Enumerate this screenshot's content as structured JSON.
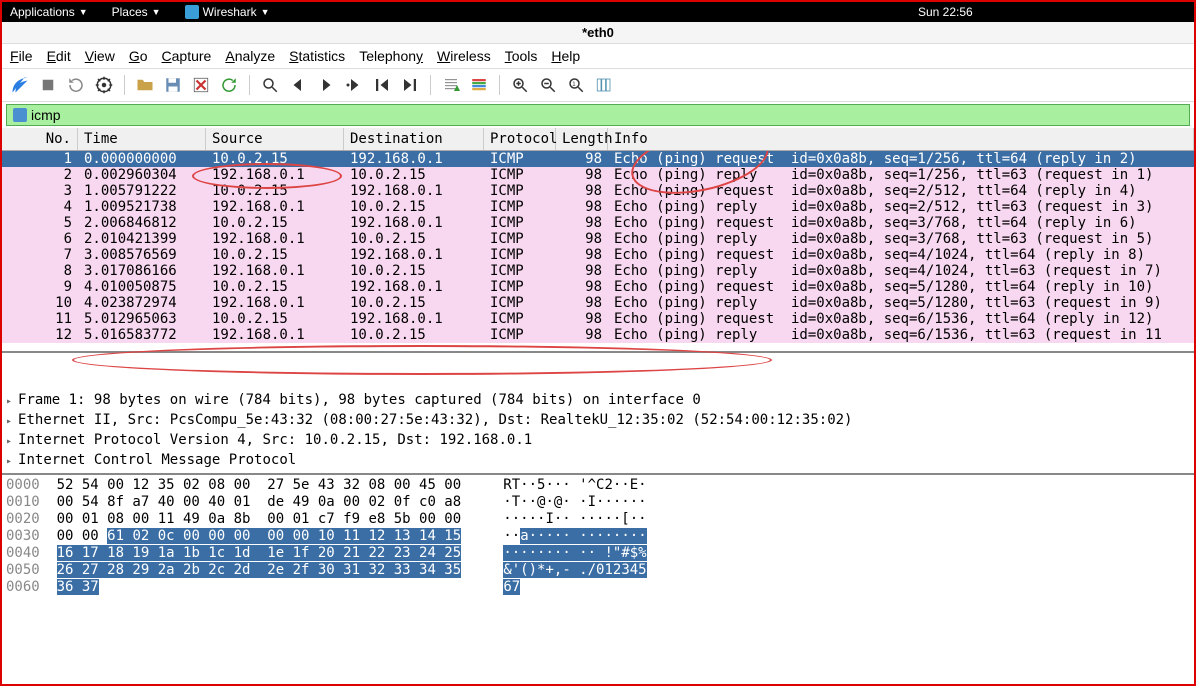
{
  "topbar": {
    "applications": "Applications",
    "places": "Places",
    "wireshark": "Wireshark",
    "clock": "Sun 22:56"
  },
  "title": "*eth0",
  "menubar": [
    "File",
    "Edit",
    "View",
    "Go",
    "Capture",
    "Analyze",
    "Statistics",
    "Telephony",
    "Wireless",
    "Tools",
    "Help"
  ],
  "filter": {
    "value": "icmp"
  },
  "columns": {
    "no": "No.",
    "time": "Time",
    "src": "Source",
    "dst": "Destination",
    "proto": "Protocol",
    "len": "Length",
    "info": "Info"
  },
  "packets": [
    {
      "no": "1",
      "time": "0.000000000",
      "src": "10.0.2.15",
      "dst": "192.168.0.1",
      "proto": "ICMP",
      "len": "98",
      "info": "Echo (ping) request  id=0x0a8b, seq=1/256, ttl=64 (reply in 2)",
      "sel": true
    },
    {
      "no": "2",
      "time": "0.002960304",
      "src": "192.168.0.1",
      "dst": "10.0.2.15",
      "proto": "ICMP",
      "len": "98",
      "info": "Echo (ping) reply    id=0x0a8b, seq=1/256, ttl=63 (request in 1)"
    },
    {
      "no": "3",
      "time": "1.005791222",
      "src": "10.0.2.15",
      "dst": "192.168.0.1",
      "proto": "ICMP",
      "len": "98",
      "info": "Echo (ping) request  id=0x0a8b, seq=2/512, ttl=64 (reply in 4)"
    },
    {
      "no": "4",
      "time": "1.009521738",
      "src": "192.168.0.1",
      "dst": "10.0.2.15",
      "proto": "ICMP",
      "len": "98",
      "info": "Echo (ping) reply    id=0x0a8b, seq=2/512, ttl=63 (request in 3)"
    },
    {
      "no": "5",
      "time": "2.006846812",
      "src": "10.0.2.15",
      "dst": "192.168.0.1",
      "proto": "ICMP",
      "len": "98",
      "info": "Echo (ping) request  id=0x0a8b, seq=3/768, ttl=64 (reply in 6)"
    },
    {
      "no": "6",
      "time": "2.010421399",
      "src": "192.168.0.1",
      "dst": "10.0.2.15",
      "proto": "ICMP",
      "len": "98",
      "info": "Echo (ping) reply    id=0x0a8b, seq=3/768, ttl=63 (request in 5)"
    },
    {
      "no": "7",
      "time": "3.008576569",
      "src": "10.0.2.15",
      "dst": "192.168.0.1",
      "proto": "ICMP",
      "len": "98",
      "info": "Echo (ping) request  id=0x0a8b, seq=4/1024, ttl=64 (reply in 8)"
    },
    {
      "no": "8",
      "time": "3.017086166",
      "src": "192.168.0.1",
      "dst": "10.0.2.15",
      "proto": "ICMP",
      "len": "98",
      "info": "Echo (ping) reply    id=0x0a8b, seq=4/1024, ttl=63 (request in 7)"
    },
    {
      "no": "9",
      "time": "4.010050875",
      "src": "10.0.2.15",
      "dst": "192.168.0.1",
      "proto": "ICMP",
      "len": "98",
      "info": "Echo (ping) request  id=0x0a8b, seq=5/1280, ttl=64 (reply in 10)"
    },
    {
      "no": "10",
      "time": "4.023872974",
      "src": "192.168.0.1",
      "dst": "10.0.2.15",
      "proto": "ICMP",
      "len": "98",
      "info": "Echo (ping) reply    id=0x0a8b, seq=5/1280, ttl=63 (request in 9)"
    },
    {
      "no": "11",
      "time": "5.012965063",
      "src": "10.0.2.15",
      "dst": "192.168.0.1",
      "proto": "ICMP",
      "len": "98",
      "info": "Echo (ping) request  id=0x0a8b, seq=6/1536, ttl=64 (reply in 12)"
    },
    {
      "no": "12",
      "time": "5.016583772",
      "src": "192.168.0.1",
      "dst": "10.0.2.15",
      "proto": "ICMP",
      "len": "98",
      "info": "Echo (ping) reply    id=0x0a8b, seq=6/1536, ttl=63 (request in 11"
    }
  ],
  "details": [
    "Frame 1: 98 bytes on wire (784 bits), 98 bytes captured (784 bits) on interface 0",
    "Ethernet II, Src: PcsCompu_5e:43:32 (08:00:27:5e:43:32), Dst: RealtekU_12:35:02 (52:54:00:12:35:02)",
    "Internet Protocol Version 4, Src: 10.0.2.15, Dst: 192.168.0.1",
    "Internet Control Message Protocol"
  ],
  "hex": [
    {
      "off": "0000",
      "b": "52 54 00 12 35 02 08 00  27 5e 43 32 08 00 45 00",
      "a": "RT··5··· '^C2··E·"
    },
    {
      "off": "0010",
      "b": "00 54 8f a7 40 00 40 01  de 49 0a 00 02 0f c0 a8",
      "a": "·T··@·@· ·I······"
    },
    {
      "off": "0020",
      "b": "00 01 08 00 11 49 0a 8b  00 01 c7 f9 e8 5b 00 00",
      "a": "·····I·· ·····[··"
    },
    {
      "off": "0030",
      "b": "00 00 ",
      "bh": "61 02 0c 00 00 00  00 00 10 11 12 13 14 15",
      "a": "··",
      "ah": "a····· ········"
    },
    {
      "off": "0040",
      "bh": "16 17 18 19 1a 1b 1c 1d  1e 1f 20 21 22 23 24 25",
      "ah": "········ ·· !\"#$%"
    },
    {
      "off": "0050",
      "bh": "26 27 28 29 2a 2b 2c 2d  2e 2f 30 31 32 33 34 35",
      "ah": "&'()*+,- ./012345"
    },
    {
      "off": "0060",
      "bh": "36 37",
      "ah": "67"
    }
  ]
}
